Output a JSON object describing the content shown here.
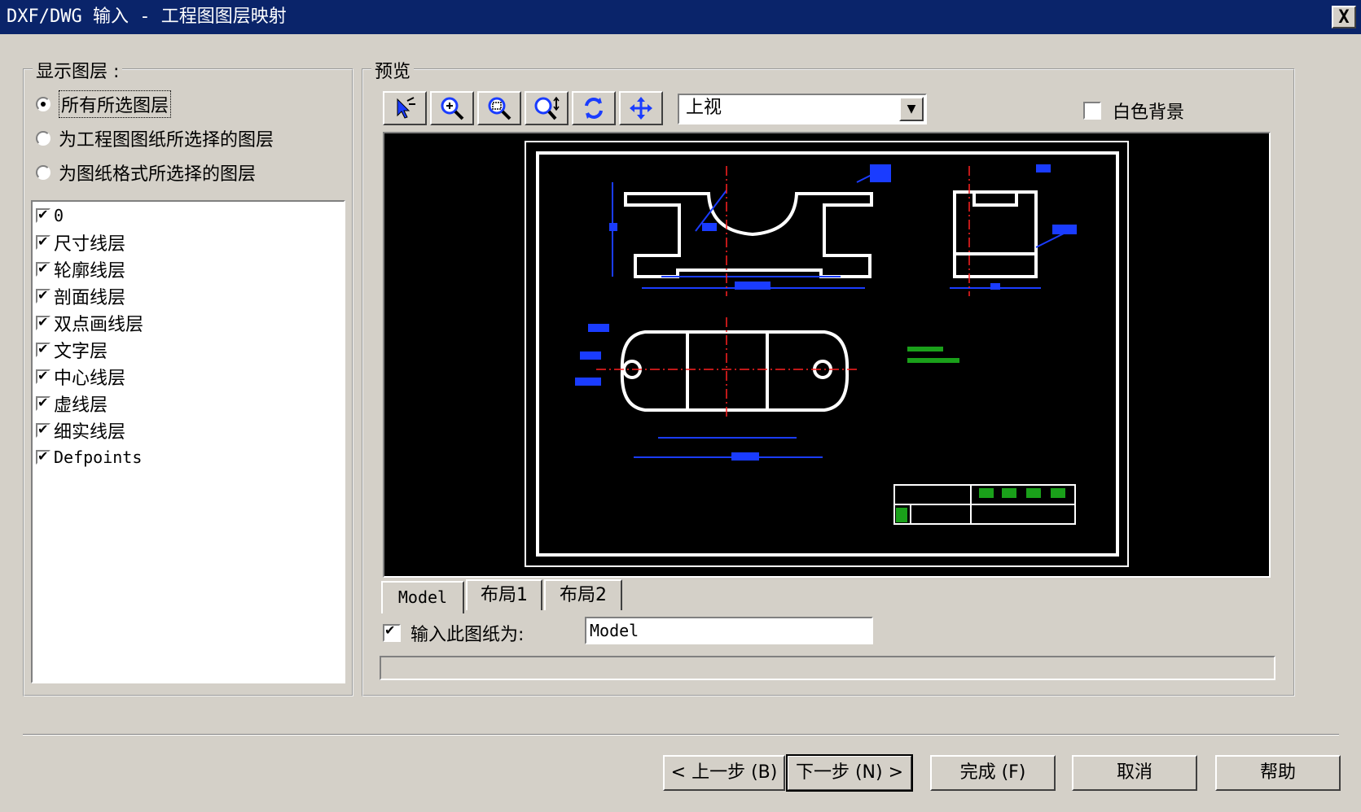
{
  "window": {
    "title": "DXF/DWG 输入 - 工程图图层映射",
    "close_label": "X"
  },
  "layer_group": {
    "title": "显示图层 :",
    "options": [
      "所有所选图层",
      "为工程图图纸所选择的图层",
      "为图纸格式所选择的图层"
    ],
    "selected_index": 0,
    "layers": [
      {
        "name": "0",
        "checked": true
      },
      {
        "name": "尺寸线层",
        "checked": true
      },
      {
        "name": "轮廓线层",
        "checked": true
      },
      {
        "name": "剖面线层",
        "checked": true
      },
      {
        "name": "双点画线层",
        "checked": true
      },
      {
        "name": "文字层",
        "checked": true
      },
      {
        "name": "中心线层",
        "checked": true
      },
      {
        "name": "虚线层",
        "checked": true
      },
      {
        "name": "细实线层",
        "checked": true
      },
      {
        "name": "Defpoints",
        "checked": true
      }
    ]
  },
  "preview": {
    "title": "预览",
    "toolbar_icons": [
      "select-icon",
      "zoom-in-icon",
      "zoom-window-icon",
      "zoom-fit-icon",
      "rotate-icon",
      "pan-icon"
    ],
    "view_select": "上视",
    "white_bg_label": "白色背景",
    "white_bg_checked": false,
    "tabs": [
      "Model",
      "布局1",
      "布局2"
    ],
    "active_tab": 0,
    "import_label": "输入此图纸为:",
    "import_checked": true,
    "import_value": "Model",
    "colors": {
      "outline": "#ffffff",
      "dimension": "#1a3cff",
      "center": "#ff2020",
      "text": "#1aa01a"
    }
  },
  "buttons": {
    "back": "< 上一步 (B)",
    "next": "下一步 (N) >",
    "finish": "完成 (F)",
    "cancel": "取消",
    "help": "帮助"
  }
}
